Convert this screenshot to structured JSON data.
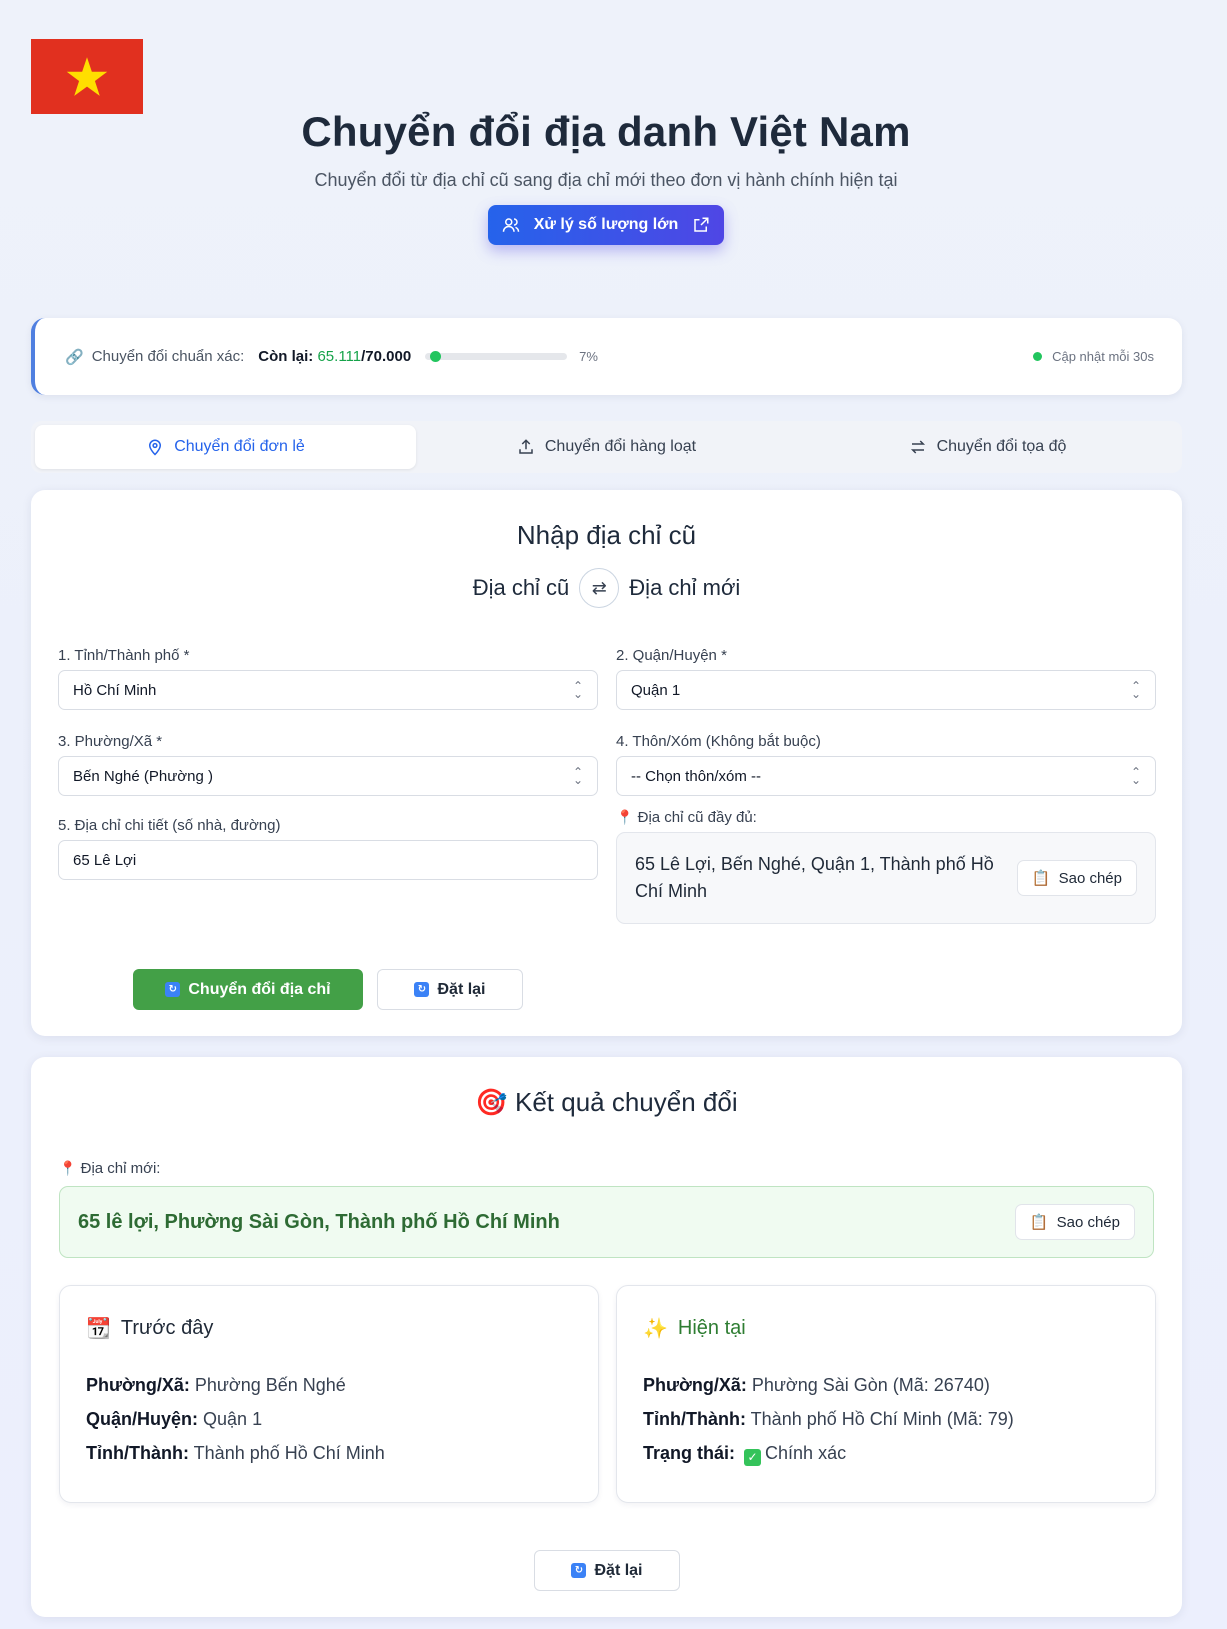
{
  "header": {
    "title": "Chuyển đổi địa danh Việt Nam",
    "subtitle": "Chuyển đổi từ địa chỉ cũ sang địa chỉ mới theo đơn vị hành chính hiện tại",
    "bulk_button": "Xử lý số lượng lớn"
  },
  "quota": {
    "label": "Chuyển đổi chuẩn xác:",
    "remaining_label": "Còn lại:",
    "remaining": "65.111",
    "total": "/70.000",
    "percent_text": "7%",
    "percent_value": 7,
    "update_text": "Cập nhật mỗi 30s"
  },
  "tabs": [
    {
      "label": "Chuyển đổi đơn lẻ",
      "icon": "map-pin-icon",
      "active": true
    },
    {
      "label": "Chuyển đổi hàng loạt",
      "icon": "upload-icon",
      "active": false
    },
    {
      "label": "Chuyển đổi tọa độ",
      "icon": "swap-icon",
      "active": false
    }
  ],
  "form": {
    "title": "Nhập địa chỉ cũ",
    "old_label": "Địa chỉ cũ",
    "new_label": "Địa chỉ mới",
    "province_label": "1. Tỉnh/Thành phố *",
    "province_value": "Hồ Chí Minh",
    "district_label": "2. Quận/Huyện *",
    "district_value": "Quận 1",
    "ward_label": "3. Phường/Xã *",
    "ward_value": "Bến Nghé (Phường )",
    "hamlet_label": "4. Thôn/Xóm (Không bắt buộc)",
    "hamlet_value": "-- Chọn thôn/xóm --",
    "detail_label": "5. Địa chỉ chi tiết (số nhà, đường)",
    "detail_value": "65 Lê Lợi",
    "full_label": "Địa chỉ cũ đầy đủ:",
    "full_value": "65 Lê Lợi, Bến Nghé, Quận 1, Thành phố Hồ Chí Minh",
    "copy_label": "Sao chép",
    "convert_button": "Chuyển đổi địa chỉ",
    "reset_button": "Đặt lại"
  },
  "result": {
    "title": "Kết quả chuyển đổi",
    "new_label": "Địa chỉ mới:",
    "new_value": "65 lê lợi, Phường Sài Gòn, Thành phố Hồ Chí Minh",
    "copy_label": "Sao chép",
    "before": {
      "heading": "Trước đây",
      "ward_key": "Phường/Xã:",
      "ward_val": "Phường Bến Nghé",
      "district_key": "Quận/Huyện:",
      "district_val": "Quận 1",
      "province_key": "Tỉnh/Thành:",
      "province_val": "Thành phố Hồ Chí Minh"
    },
    "now": {
      "heading": "Hiện tại",
      "ward_key": "Phường/Xã:",
      "ward_val": "Phường Sài Gòn  (Mã: 26740)",
      "province_key": "Tỉnh/Thành:",
      "province_val": "Thành phố Hồ Chí Minh  (Mã: 79)",
      "status_key": "Trạng thái:",
      "status_val": "Chính xác"
    },
    "reset_button": "Đặt lại"
  },
  "colors": {
    "accent": "#2563eb",
    "success": "#43a047",
    "flag_red": "#e1301f",
    "flag_star": "#ffde00"
  }
}
